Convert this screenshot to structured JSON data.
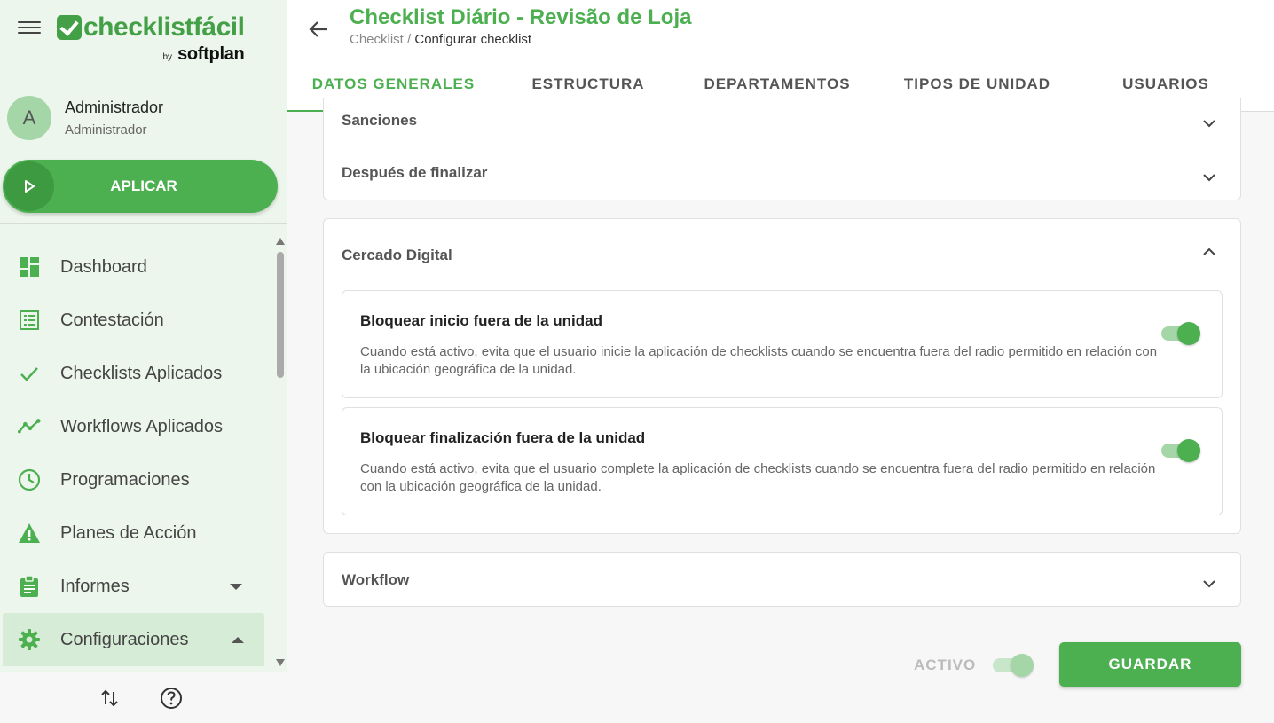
{
  "brand": {
    "logo_text": "checklistfácil",
    "by": "by",
    "brand_name": "softplan",
    "primary_color": "#4caf50"
  },
  "sidebar": {
    "menu_icon": "hamburger-icon",
    "user": {
      "initial": "A",
      "name": "Administrador",
      "role": "Administrador"
    },
    "apply_button": {
      "label": "APLICAR",
      "icon": "play-icon"
    },
    "items": [
      {
        "label": "Dashboard",
        "icon": "dashboard-icon"
      },
      {
        "label": "Contestación",
        "icon": "list-icon"
      },
      {
        "label": "Checklists Aplicados",
        "icon": "check-icon"
      },
      {
        "label": "Workflows Aplicados",
        "icon": "trend-icon"
      },
      {
        "label": "Programaciones",
        "icon": "clock-icon"
      },
      {
        "label": "Planes de Acción",
        "icon": "warning-icon"
      },
      {
        "label": "Informes",
        "icon": "clipboard-icon",
        "expandable": true,
        "expanded": false
      },
      {
        "label": "Configuraciones",
        "icon": "gear-icon",
        "expandable": true,
        "expanded": true,
        "active": true
      }
    ],
    "footer": {
      "sort_icon": "sort-arrows-icon",
      "help_icon": "help-icon"
    }
  },
  "header": {
    "back_icon": "arrow-left-icon",
    "title": "Checklist Diário - Revisão de Loja",
    "breadcrumb": {
      "parent": "Checklist",
      "separator": "/",
      "current": "Configurar checklist"
    },
    "tabs": [
      {
        "label": "DATOS GENERALES",
        "active": true
      },
      {
        "label": "ESTRUCTURA",
        "active": false
      },
      {
        "label": "DEPARTAMENTOS",
        "active": false
      },
      {
        "label": "TIPOS DE UNIDAD",
        "active": false
      },
      {
        "label": "USUARIOS",
        "active": false
      }
    ]
  },
  "main": {
    "collapsed_sections_top": [
      {
        "label": "Sanciones",
        "expanded": false
      },
      {
        "label": "Después de finalizar",
        "expanded": false
      }
    ],
    "geofence": {
      "label": "Cercado Digital",
      "expanded": true,
      "options": [
        {
          "title": "Bloquear inicio fuera de la unidad",
          "description": "Cuando está activo, evita que el usuario inicie la aplicación de checklists cuando se encuentra fuera del radio permitido en relación con la ubicación geográfica de la unidad.",
          "enabled": true
        },
        {
          "title": "Bloquear finalización fuera de la unidad",
          "description": "Cuando está activo, evita que el usuario complete la aplicación de checklists cuando se encuentra fuera del radio permitido en relación con la ubicación geográfica de la unidad.",
          "enabled": true
        }
      ]
    },
    "workflow": {
      "label": "Workflow",
      "expanded": false
    },
    "footer": {
      "active_label": "ACTIVO",
      "active_enabled": true,
      "save_label": "GUARDAR"
    }
  }
}
